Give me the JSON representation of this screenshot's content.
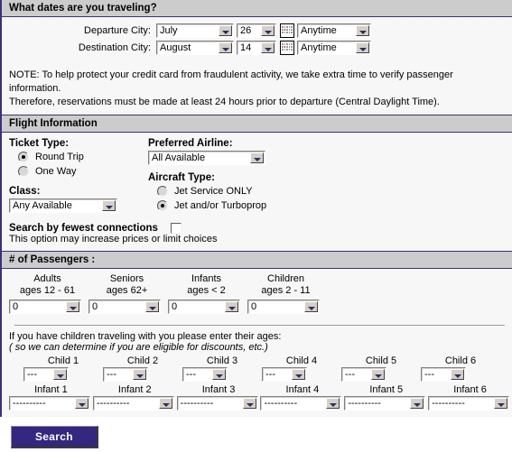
{
  "dates_section": {
    "title": "What dates are you traveling?",
    "rows": [
      {
        "label": "Departure City:",
        "month": "July",
        "day": "26",
        "time": "Anytime",
        "calendar_icon": "calendar-icon"
      },
      {
        "label": "Destination City:",
        "month": "August",
        "day": "14",
        "time": "Anytime",
        "calendar_icon": "calendar-icon"
      }
    ]
  },
  "note": {
    "line1": "NOTE: To help protect your credit card from fraudulent activity, we take extra time to verify passenger information.",
    "line2": "Therefore, reservations must be made at least 24 hours prior to departure (Central Daylight Time)."
  },
  "flight_information": {
    "title": "Flight Information",
    "ticket_type": {
      "label": "Ticket Type:",
      "options": [
        {
          "label": "Round Trip",
          "checked": true
        },
        {
          "label": "One Way",
          "checked": false
        }
      ]
    },
    "class": {
      "label": "Class:",
      "value": "Any Available"
    },
    "preferred_airline": {
      "label": "Preferred Airline:",
      "value": "All Available"
    },
    "aircraft_type": {
      "label": "Aircraft Type:",
      "options": [
        {
          "label": "Jet Service ONLY",
          "checked": false
        },
        {
          "label": "Jet and/or Turboprop",
          "checked": true
        }
      ]
    },
    "fewest_connections": {
      "label": "Search by fewest connections",
      "checked": false,
      "subtext": "This option may increase prices or limit choices"
    }
  },
  "passengers": {
    "title": "# of Passengers :",
    "categories": [
      {
        "name": "Adults",
        "ages": "ages 12 - 61",
        "value": "0"
      },
      {
        "name": "Seniors",
        "ages": "ages 62+",
        "value": "0"
      },
      {
        "name": "Infants",
        "ages": "ages < 2",
        "value": "0"
      },
      {
        "name": "Children",
        "ages": "ages 2 - 11",
        "value": "0"
      }
    ],
    "children_intro": "If you have children traveling with you please enter their ages:",
    "children_intro_italic": "( so we can determine if you are eligible for discounts, etc.)",
    "children": [
      {
        "label": "Child 1",
        "value": "---"
      },
      {
        "label": "Child 2",
        "value": "---"
      },
      {
        "label": "Child 3",
        "value": "---"
      },
      {
        "label": "Child 4",
        "value": "---"
      },
      {
        "label": "Child 5",
        "value": "---"
      },
      {
        "label": "Child 6",
        "value": "---"
      }
    ],
    "infants": [
      {
        "label": "Infant 1",
        "value": "----------"
      },
      {
        "label": "Infant 2",
        "value": "----------"
      },
      {
        "label": "Infant 3",
        "value": "----------"
      },
      {
        "label": "Infant 4",
        "value": "----------"
      },
      {
        "label": "Infant 5",
        "value": "----------"
      },
      {
        "label": "Infant 6",
        "value": "----------"
      }
    ]
  },
  "actions": {
    "search_label": "Search"
  },
  "colors": {
    "accent_border": "#3b2f80",
    "header_bg": "#cccccc",
    "body_bg": "#f7f7f7",
    "button_bg": "#33277f",
    "arrow": "#2b2b6b"
  }
}
